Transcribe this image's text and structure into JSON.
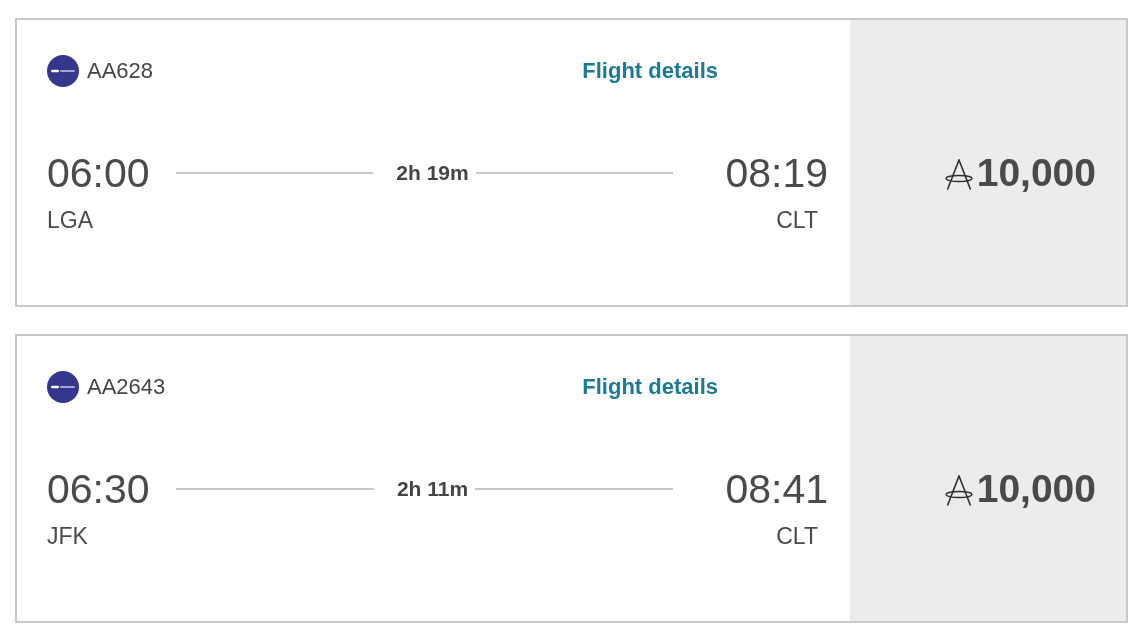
{
  "flights": [
    {
      "flight_number": "AA628",
      "details_link": "Flight details",
      "departure": {
        "time": "06:00",
        "airport": "LGA"
      },
      "duration": "2h 19m",
      "arrival": {
        "time": "08:19",
        "airport": "CLT"
      },
      "price": "10,000"
    },
    {
      "flight_number": "AA2643",
      "details_link": "Flight details",
      "departure": {
        "time": "06:30",
        "airport": "JFK"
      },
      "duration": "2h 11m",
      "arrival": {
        "time": "08:41",
        "airport": "CLT"
      },
      "price": "10,000"
    }
  ]
}
